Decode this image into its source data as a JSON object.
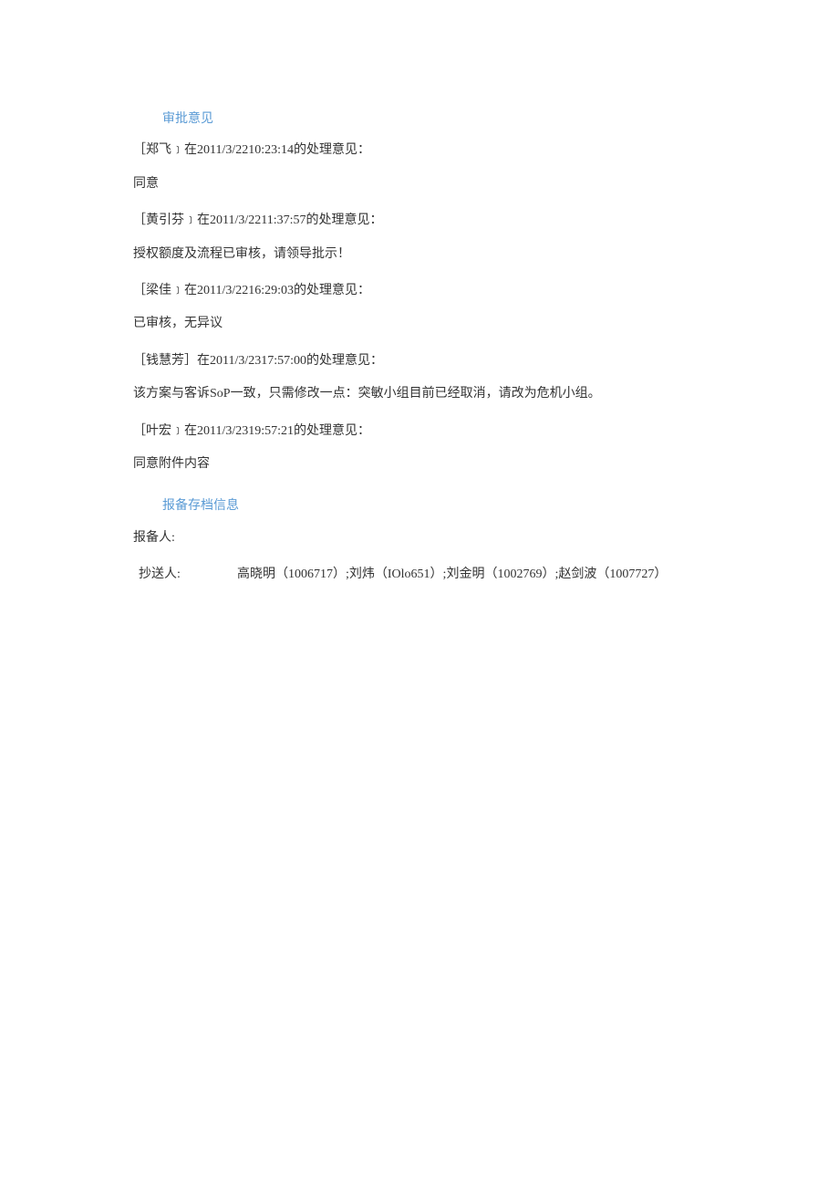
{
  "approval": {
    "heading": "审批意见",
    "opinions": [
      {
        "header": "［郑飞﹞在2011/3/2210:23:14的处理意见：",
        "content": "同意"
      },
      {
        "header": "［黄引芬﹞在2011/3/2211:37:57的处理意见：",
        "content": "授权额度及流程已审核，请领导批示！"
      },
      {
        "header": "［梁佳﹞在2011/3/2216:29:03的处理意见：",
        "content": "已审核，无异议"
      },
      {
        "header": "［钱慧芳］在2011/3/2317:57:00的处理意见：",
        "content": "该方案与客诉SoP一致，只需修改一点：突敏小组目前已经取消，请改为危机小组。"
      },
      {
        "header": "［叶宏﹞在2011/3/2319:57:21的处理意见：",
        "content": "同意附件内容"
      }
    ]
  },
  "archive": {
    "heading": "报备存档信息",
    "reporter_label": "报备人:",
    "cc_label": "抄送人:",
    "cc_value": "高晓明（1006717）;刘炜（IOlo651）;刘金明（1002769）;赵剑波（1007727）"
  }
}
